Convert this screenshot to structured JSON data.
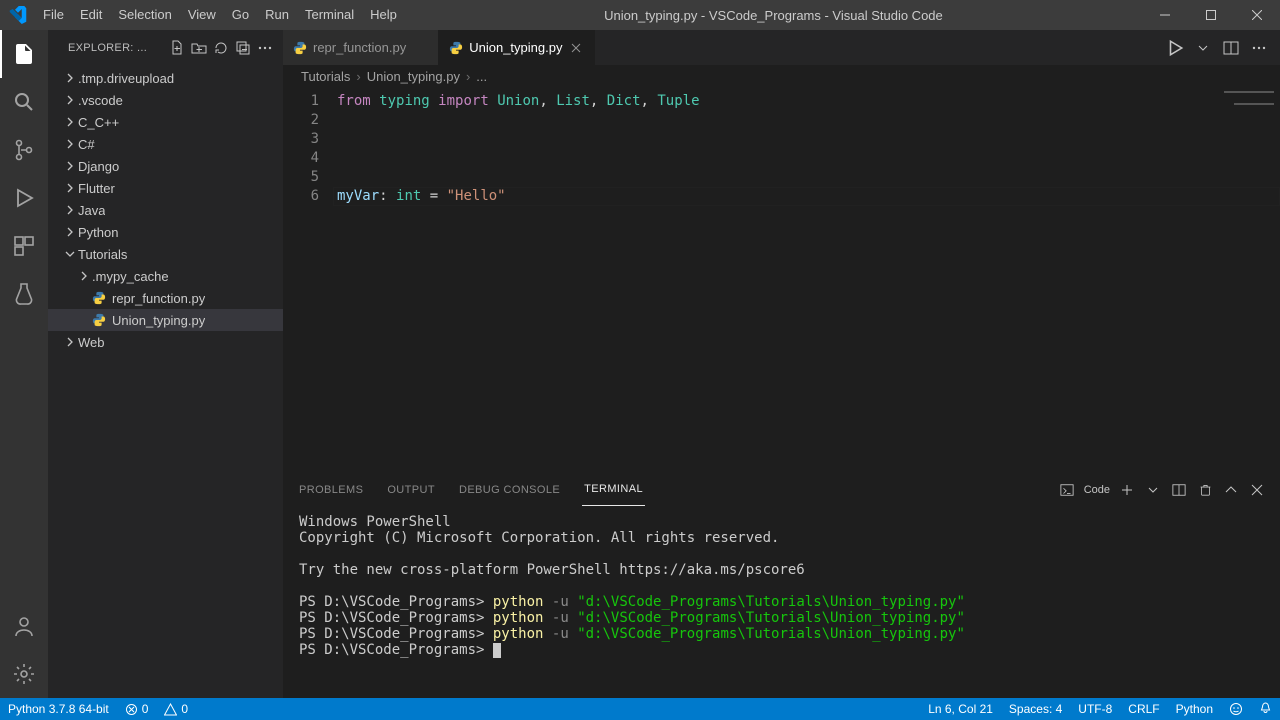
{
  "window": {
    "title": "Union_typing.py - VSCode_Programs - Visual Studio Code"
  },
  "menu": [
    "File",
    "Edit",
    "Selection",
    "View",
    "Go",
    "Run",
    "Terminal",
    "Help"
  ],
  "explorer": {
    "header": "EXPLORER: ...",
    "tree": [
      {
        "kind": "folder",
        "label": ".tmp.driveupload",
        "depth": 0,
        "expanded": false
      },
      {
        "kind": "folder",
        "label": ".vscode",
        "depth": 0,
        "expanded": false
      },
      {
        "kind": "folder",
        "label": "C_C++",
        "depth": 0,
        "expanded": false
      },
      {
        "kind": "folder",
        "label": "C#",
        "depth": 0,
        "expanded": false
      },
      {
        "kind": "folder",
        "label": "Django",
        "depth": 0,
        "expanded": false
      },
      {
        "kind": "folder",
        "label": "Flutter",
        "depth": 0,
        "expanded": false
      },
      {
        "kind": "folder",
        "label": "Java",
        "depth": 0,
        "expanded": false
      },
      {
        "kind": "folder",
        "label": "Python",
        "depth": 0,
        "expanded": false
      },
      {
        "kind": "folder",
        "label": "Tutorials",
        "depth": 0,
        "expanded": true
      },
      {
        "kind": "folder",
        "label": ".mypy_cache",
        "depth": 1,
        "expanded": false
      },
      {
        "kind": "file",
        "label": "repr_function.py",
        "depth": 1,
        "icon": "python"
      },
      {
        "kind": "file",
        "label": "Union_typing.py",
        "depth": 1,
        "icon": "python",
        "selected": true
      },
      {
        "kind": "folder",
        "label": "Web",
        "depth": 0,
        "expanded": false
      }
    ]
  },
  "tabs": [
    {
      "label": "repr_function.py",
      "icon": "python",
      "active": false
    },
    {
      "label": "Union_typing.py",
      "icon": "python",
      "active": true,
      "closeVisible": true
    }
  ],
  "breadcrumbs": [
    "Tutorials",
    "Union_typing.py",
    "..."
  ],
  "code": {
    "lines": [
      {
        "n": 1,
        "tokens": [
          [
            "kw",
            "from"
          ],
          [
            "p",
            " "
          ],
          [
            "mod",
            "typing"
          ],
          [
            "p",
            " "
          ],
          [
            "kw",
            "import"
          ],
          [
            "p",
            " "
          ],
          [
            "ty",
            "Union"
          ],
          [
            "p",
            ", "
          ],
          [
            "ty",
            "List"
          ],
          [
            "p",
            ", "
          ],
          [
            "ty",
            "Dict"
          ],
          [
            "p",
            ", "
          ],
          [
            "ty",
            "Tuple"
          ]
        ]
      },
      {
        "n": 2,
        "tokens": []
      },
      {
        "n": 3,
        "tokens": []
      },
      {
        "n": 4,
        "tokens": []
      },
      {
        "n": 5,
        "tokens": []
      },
      {
        "n": 6,
        "current": true,
        "tokens": [
          [
            "id",
            "myVar"
          ],
          [
            "p",
            ": "
          ],
          [
            "ty",
            "int"
          ],
          [
            "p",
            " = "
          ],
          [
            "str",
            "\"Hello\""
          ]
        ]
      }
    ]
  },
  "panel": {
    "tabs": [
      "PROBLEMS",
      "OUTPUT",
      "DEBUG CONSOLE",
      "TERMINAL"
    ],
    "active": "TERMINAL",
    "terminalName": "Code",
    "terminal": {
      "intro1": "Windows PowerShell",
      "intro2": "Copyright (C) Microsoft Corporation. All rights reserved.",
      "intro3": "Try the new cross-platform PowerShell https://aka.ms/pscore6",
      "prompt": "PS D:\\VSCode_Programs>",
      "cmd": "python",
      "flag": "-u",
      "arg": "\"d:\\VSCode_Programs\\Tutorials\\Union_typing.py\"",
      "repeat": 3
    }
  },
  "status": {
    "left": [
      {
        "label": "Python 3.7.8 64-bit"
      },
      {
        "icon": "error",
        "label": "0"
      },
      {
        "icon": "warning",
        "label": "0"
      }
    ],
    "right": [
      {
        "label": "Ln 6, Col 21"
      },
      {
        "label": "Spaces: 4"
      },
      {
        "label": "UTF-8"
      },
      {
        "label": "CRLF"
      },
      {
        "label": "Python"
      },
      {
        "icon": "feedback"
      },
      {
        "icon": "bell"
      }
    ]
  },
  "colors": {
    "accent": "#007acc"
  }
}
